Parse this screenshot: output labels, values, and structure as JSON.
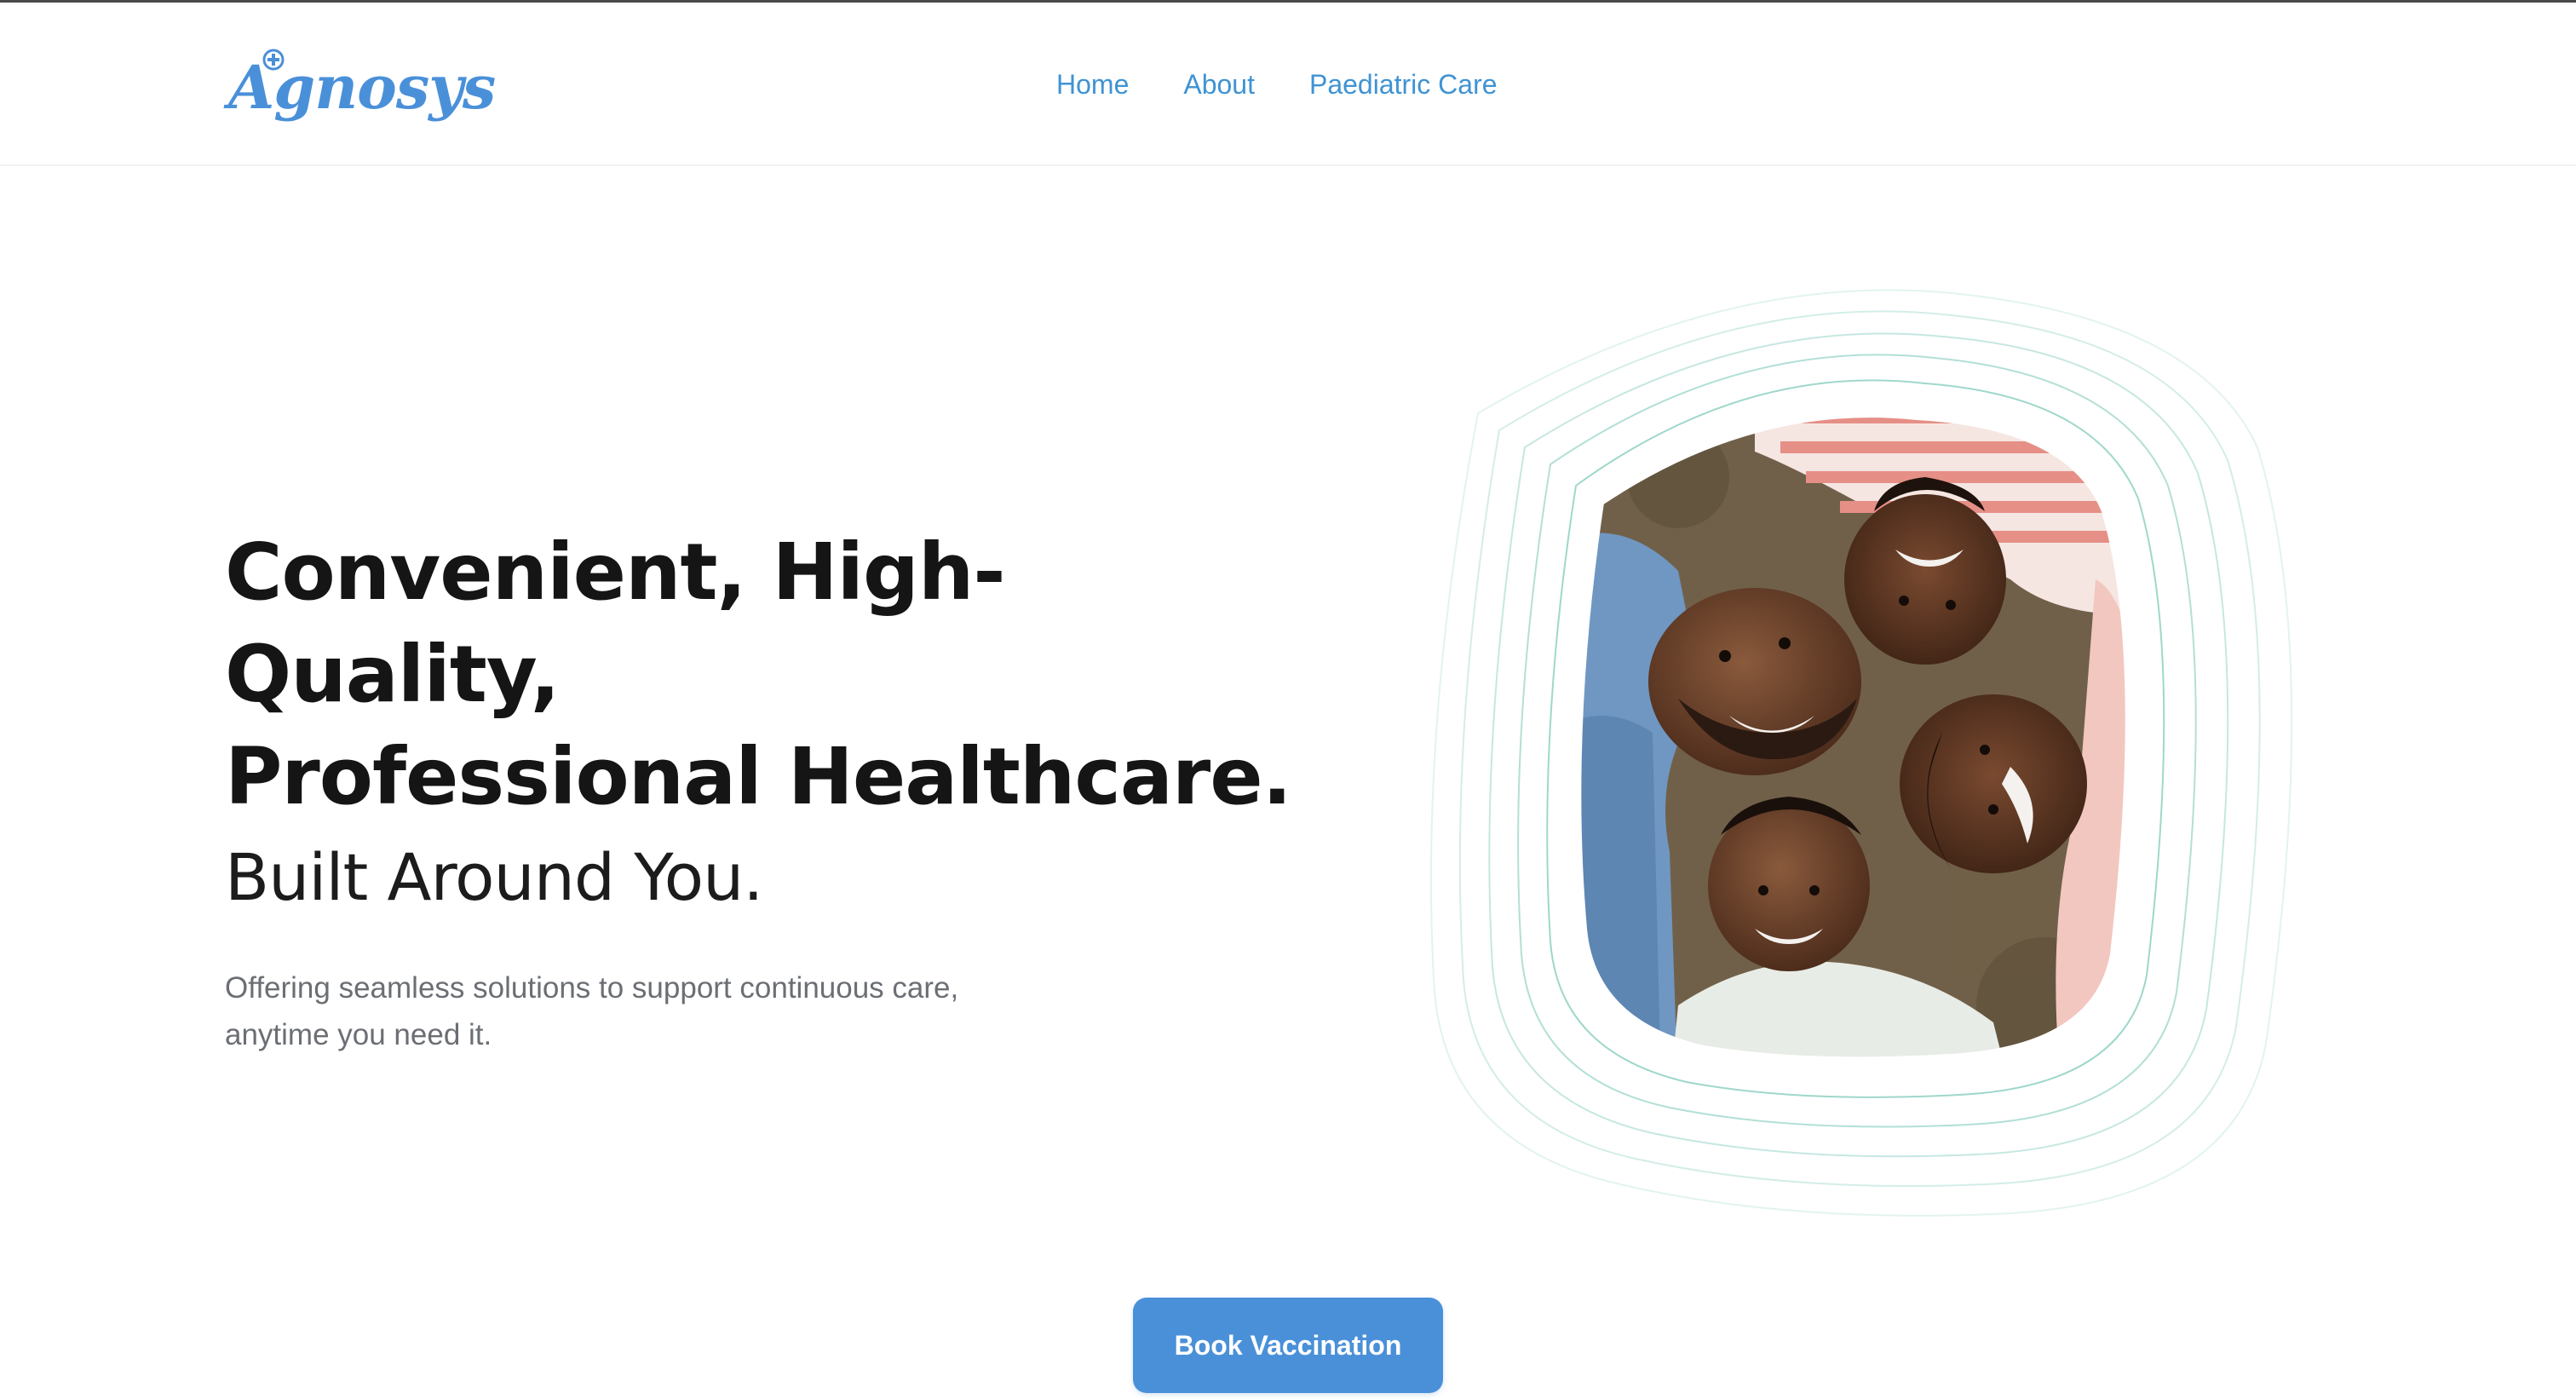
{
  "brand": {
    "name": "Agnosys",
    "color": "#4a90d9"
  },
  "nav": {
    "items": [
      {
        "label": "Home"
      },
      {
        "label": "About"
      },
      {
        "label": "Paediatric Care"
      }
    ],
    "link_color": "#3f93d3"
  },
  "hero": {
    "headline_line1": "Convenient, High-Quality,",
    "headline_line2": "Professional Healthcare.",
    "subheadline": "Built Around You.",
    "description": "Offering seamless solutions to support continuous care, anytime you need it.",
    "image": {
      "subject": "Smiling family of four lying head-to-head on a rug",
      "frame_line_color": "#8fd1c3"
    }
  },
  "cta": {
    "label": "Book Vaccination",
    "color": "#4a90d9"
  }
}
